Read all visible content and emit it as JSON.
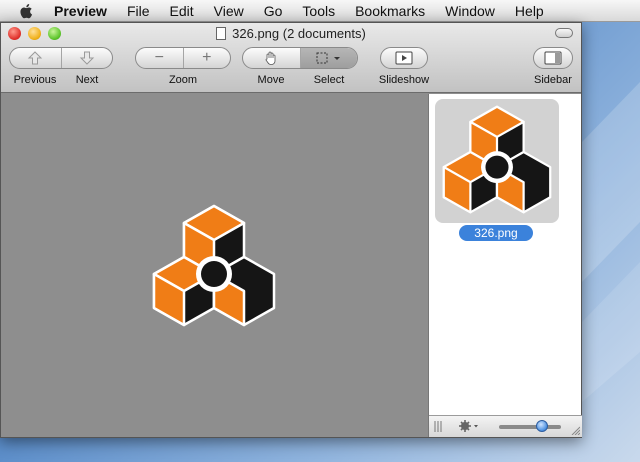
{
  "menubar": {
    "app_name": "Preview",
    "items": [
      "File",
      "Edit",
      "View",
      "Go",
      "Tools",
      "Bookmarks",
      "Window",
      "Help"
    ]
  },
  "window": {
    "title": "326.png (2 documents)"
  },
  "toolbar": {
    "previous_label": "Previous",
    "next_label": "Next",
    "zoom_label": "Zoom",
    "move_label": "Move",
    "select_label": "Select",
    "slideshow_label": "Slideshow",
    "sidebar_label": "Sidebar",
    "zoom_out_glyph": "−",
    "zoom_in_glyph": "+"
  },
  "sidebar": {
    "thumbnails": [
      {
        "label": "326.png",
        "selected": true
      }
    ],
    "size_slider_level": 0.7
  },
  "colors": {
    "logo_orange": "#f07d16",
    "logo_dark": "#151515",
    "selection_blue": "#3b82db"
  },
  "icons": {
    "previous": "up-arrow-icon",
    "next": "down-arrow-icon",
    "move": "hand-icon",
    "select": "marquee-icon",
    "slideshow": "play-screen-icon",
    "sidebar": "sidebar-icon",
    "gear": "gear-icon"
  }
}
